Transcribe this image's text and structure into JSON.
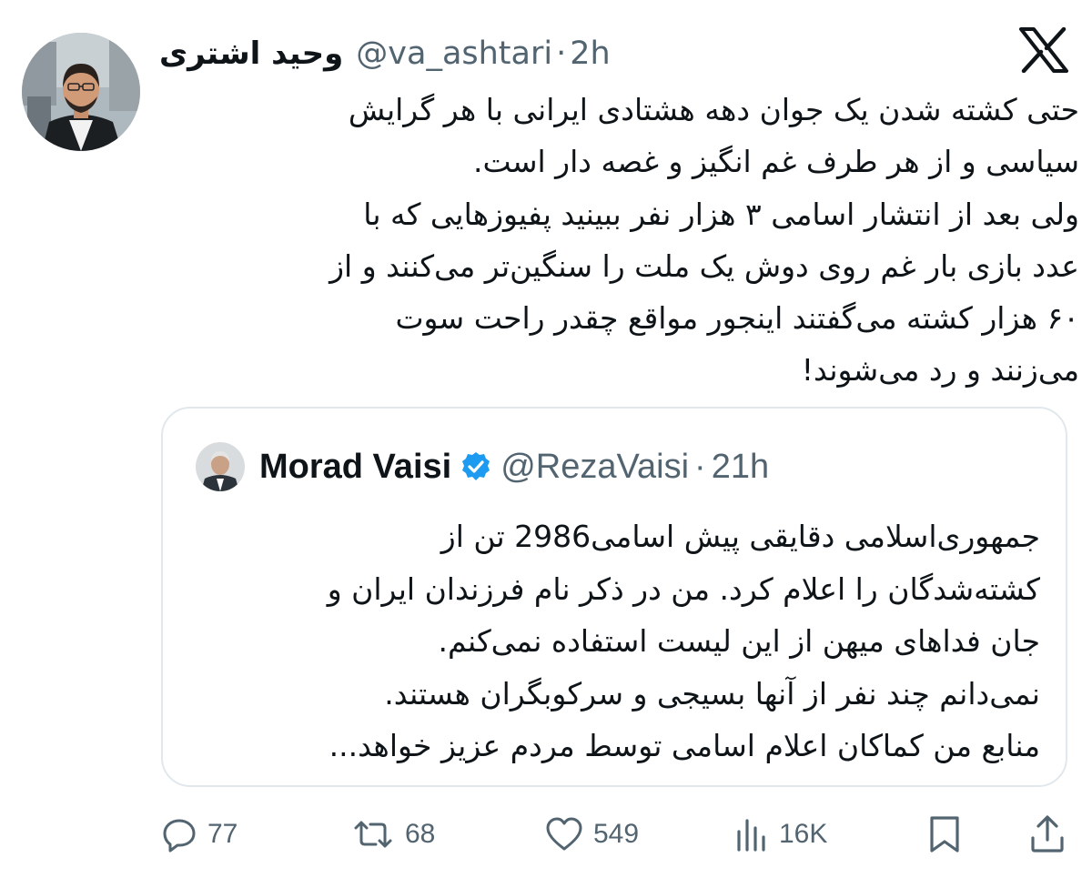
{
  "tweet": {
    "author": {
      "display_name": "وحید اشتری",
      "handle": "@va_ashtari",
      "separator": "·",
      "time": "2h"
    },
    "brand_icon": "x-logo-icon",
    "text": "حتی کشته شدن یک جوان دهه هشتادی ایرانی با هر گرایش\nسیاسی و از هر طرف غم انگیز و غصه دار است.\nولی بعد از انتشار اسامی ۳ هزار نفر ببینید پفیوزهایی که با\nعدد بازی بار غم روی دوش یک ملت را سنگین‌تر می‌کنند و از\n۶۰ هزار کشته می‌گفتند اینجور مواقع چقدر راحت سوت\nمی‌زنند و رد می‌شوند!",
    "quoted": {
      "display_name": "Morad Vaisi",
      "verified_icon": "verified-badge-icon",
      "handle": "@RezaVaisi",
      "separator": "·",
      "time": "21h",
      "text": "جمهوری‌اسلامی دقایقی پیش اسامی2986 تن از\nکشته‌شدگان را اعلام کرد. من در ذکر نام فرزندان ایران و\nجان فداهای میهن از این لیست استفاده نمی‌کنم.\nنمی‌دانم چند نفر از آنها بسیجی و سرکوبگران هستند.\nمنابع من کماکان اعلام اسامی توسط مردم عزیز خواهد..."
    },
    "actions": {
      "replies": {
        "icon": "reply-icon",
        "count": "77"
      },
      "reposts": {
        "icon": "repost-icon",
        "count": "68"
      },
      "likes": {
        "icon": "heart-icon",
        "count": "549"
      },
      "views": {
        "icon": "views-icon",
        "count": "16K"
      },
      "bookmark": {
        "icon": "bookmark-icon"
      },
      "share": {
        "icon": "share-icon"
      }
    },
    "colors": {
      "text": "#0f1419",
      "secondary": "#536471",
      "verified": "#1d9bf0",
      "border": "#e1e8ed"
    }
  }
}
